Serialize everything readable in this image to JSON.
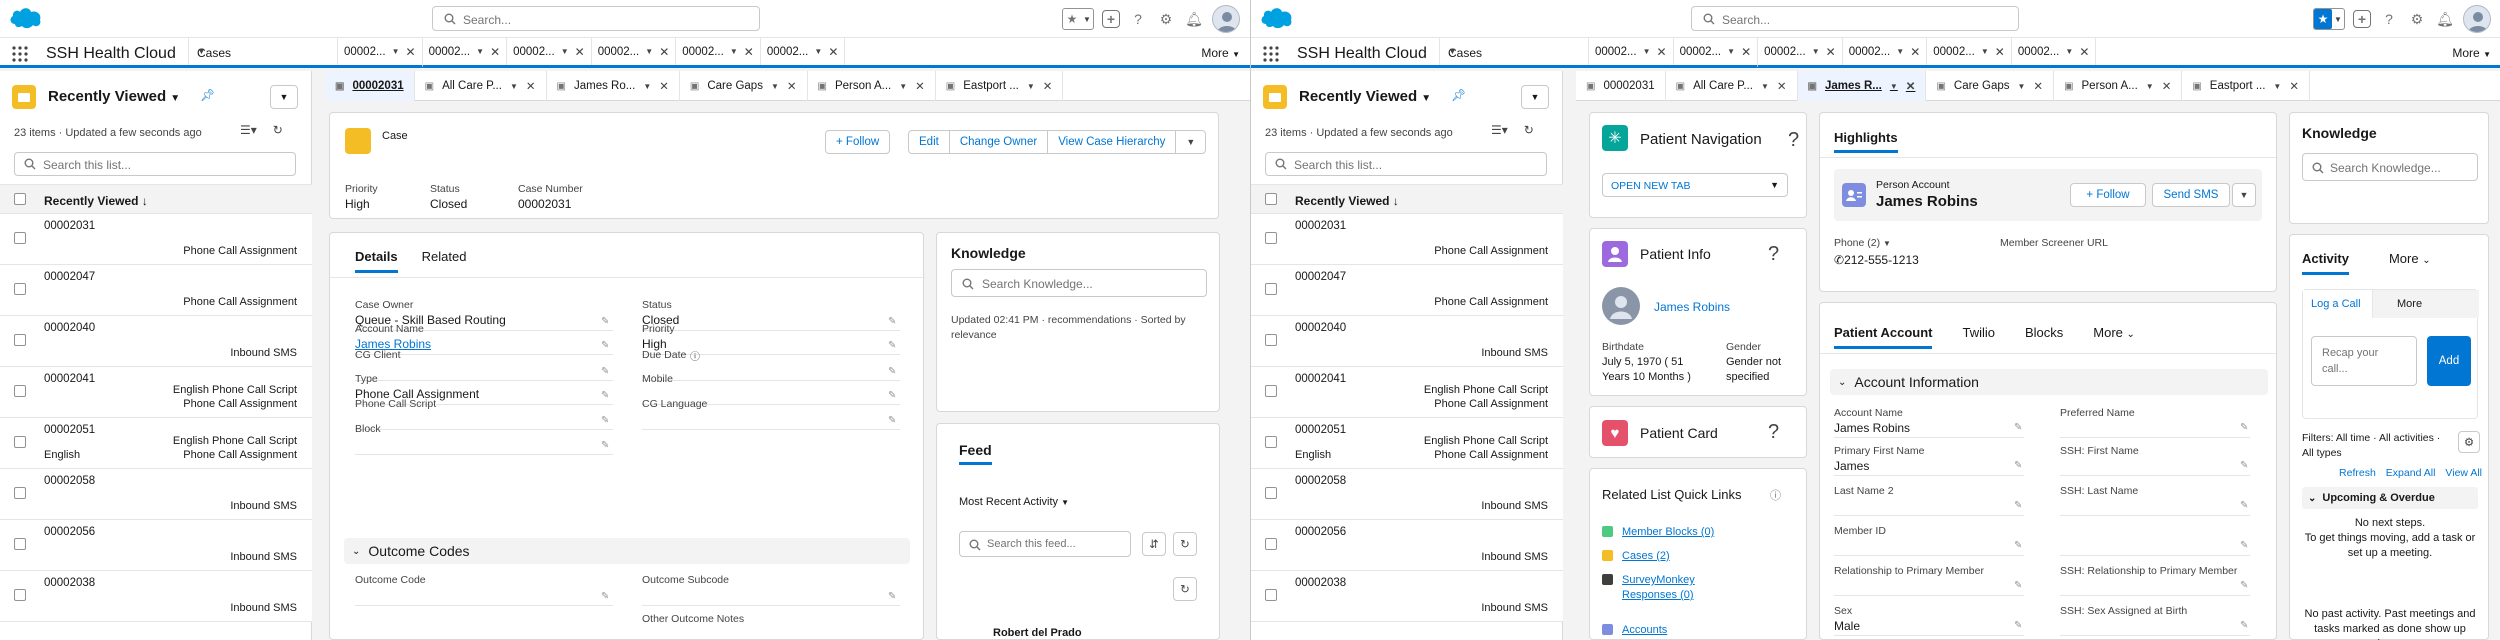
{
  "global": {
    "search_placeholder": "Search...",
    "app_name": "SSH Health Cloud",
    "object_tab": "Cases",
    "more_label": "More"
  },
  "left": {
    "workspace_tabs": [
      "00002...",
      "00002...",
      "00002...",
      "00002...",
      "00002...",
      "00002..."
    ],
    "subtabs": [
      "00002031",
      "All Care P...",
      "James Ro...",
      "Care Gaps",
      "Person A...",
      "Eastport ..."
    ],
    "case": {
      "object_label": "Case",
      "actions": [
        "Follow",
        "Edit",
        "Change Owner",
        "View Case Hierarchy"
      ],
      "highlights": [
        {
          "label": "Priority",
          "value": "High"
        },
        {
          "label": "Status",
          "value": "Closed"
        },
        {
          "label": "Case Number",
          "value": "00002031"
        }
      ]
    },
    "details": {
      "tabs": [
        "Details",
        "Related"
      ],
      "fields_left": [
        {
          "label": "Case Owner",
          "value": "Queue - Skill Based Routing"
        },
        {
          "label": "Account Name",
          "value": "James Robins"
        },
        {
          "label": "CG Client",
          "value": ""
        },
        {
          "label": "Type",
          "value": "Phone Call Assignment"
        },
        {
          "label": "Phone Call Script",
          "value": ""
        },
        {
          "label": "Block",
          "value": ""
        }
      ],
      "fields_right": [
        {
          "label": "Status",
          "value": "Closed"
        },
        {
          "label": "Priority",
          "value": "High"
        },
        {
          "label": "Due Date",
          "value": ""
        },
        {
          "label": "Mobile",
          "value": ""
        },
        {
          "label": "CG Language",
          "value": ""
        }
      ],
      "section": "Outcome Codes",
      "outcome_left": "Outcome Code",
      "outcome_right1": "Outcome Subcode",
      "outcome_right2": "Other Outcome Notes"
    },
    "knowledge": {
      "title": "Knowledge",
      "search_placeholder": "Search Knowledge...",
      "updated": "Updated 02:41 PM · recommendations · Sorted by relevance"
    },
    "feed": {
      "title": "Feed",
      "filter": "Most Recent Activity",
      "search_placeholder": "Search this feed...",
      "author": "Robert del Prado"
    }
  },
  "right": {
    "workspace_tabs": [
      "00002...",
      "00002...",
      "00002...",
      "00002...",
      "00002...",
      "00002..."
    ],
    "subtabs": [
      "00002031",
      "All Care P...",
      "James R...",
      "Care Gaps",
      "Person A...",
      "Eastport ..."
    ],
    "patient_nav": {
      "title": "Patient Navigation",
      "select": "OPEN NEW TAB"
    },
    "patient_info": {
      "title": "Patient Info",
      "name": "James Robins",
      "birthdate_label": "Birthdate",
      "birthdate": "July 5, 1970 ( 51 Years 10 Months )",
      "gender_label": "Gender",
      "gender": "Gender not specified"
    },
    "patient_card": {
      "title": "Patient Card"
    },
    "quick_links": {
      "title": "Related List Quick Links",
      "items": [
        "Member Blocks (0)",
        "Cases (2)",
        "SurveyMonkey Responses (0)",
        "Accounts"
      ]
    },
    "highlights": {
      "tab": "Highlights",
      "object": "Person Account",
      "name": "James Robins",
      "follow": "Follow",
      "send_sms": "Send SMS",
      "phone_label": "Phone (2)",
      "phone": "212-555-1213",
      "msu_label": "Member Screener URL"
    },
    "account": {
      "tabs": [
        "Patient Account",
        "Twilio",
        "Blocks",
        "More"
      ],
      "section": "Account Information",
      "fields_left": [
        {
          "label": "Account Name",
          "value": "James Robins"
        },
        {
          "label": "Primary First Name",
          "value": "James"
        },
        {
          "label": "Last Name 2",
          "value": ""
        },
        {
          "label": "Member ID",
          "value": ""
        },
        {
          "label": "Relationship to Primary Member",
          "value": ""
        },
        {
          "label": "Sex",
          "value": "Male"
        }
      ],
      "fields_right": [
        {
          "label": "Preferred Name",
          "value": ""
        },
        {
          "label": "SSH: First Name",
          "value": ""
        },
        {
          "label": "SSH: Last Name",
          "value": ""
        },
        {
          "label": "",
          "value": ""
        },
        {
          "label": "SSH: Relationship to Primary Member",
          "value": ""
        },
        {
          "label": "SSH: Sex Assigned at Birth",
          "value": ""
        }
      ]
    },
    "knowledge": {
      "title": "Knowledge",
      "search_placeholder": "Search Knowledge..."
    },
    "activity": {
      "tabs": [
        "Activity",
        "More"
      ],
      "log_tabs": [
        "Log a Call",
        "More"
      ],
      "recap_placeholder": "Recap your call...",
      "add": "Add",
      "filters": "Filters: All time · All activities · All types",
      "links": [
        "Refresh",
        "Expand All",
        "View All"
      ],
      "upcoming": "Upcoming & Overdue",
      "no_next": "No next steps.",
      "no_next_sub": "To get things moving, add a task or set up a meeting.",
      "no_past": "No past activity. Past meetings and tasks marked as done show up here."
    }
  },
  "list": {
    "title": "Recently Viewed",
    "meta": "23 items · Updated a few seconds ago",
    "search_placeholder": "Search this list...",
    "column": "Recently Viewed",
    "rows": [
      {
        "num": "00002031",
        "sub1": "",
        "sub2": "Phone Call Assignment",
        "sub0": ""
      },
      {
        "num": "00002047",
        "sub1": "",
        "sub2": "Phone Call Assignment",
        "sub0": ""
      },
      {
        "num": "00002040",
        "sub1": "",
        "sub2": "Inbound SMS",
        "sub0": ""
      },
      {
        "num": "00002041",
        "sub1": "English Phone Call Script",
        "sub2": "Phone Call Assignment",
        "sub0": ""
      },
      {
        "num": "00002051",
        "sub1": "English Phone Call Script",
        "sub2": "Phone Call Assignment",
        "sub0": "English"
      },
      {
        "num": "00002058",
        "sub1": "",
        "sub2": "Inbound SMS",
        "sub0": ""
      },
      {
        "num": "00002056",
        "sub1": "",
        "sub2": "Inbound SMS",
        "sub0": ""
      },
      {
        "num": "00002038",
        "sub1": "",
        "sub2": "Inbound SMS",
        "sub0": ""
      }
    ]
  },
  "colors": {
    "brand": "#0176d3",
    "case_icon": "#f4bc25",
    "patient_nav_icon": "#06a59a",
    "patient_info_icon": "#9c6ade",
    "patient_card_icon": "#e3526a",
    "person_account_icon": "#7f8de1",
    "add_button": "#0176d3"
  }
}
